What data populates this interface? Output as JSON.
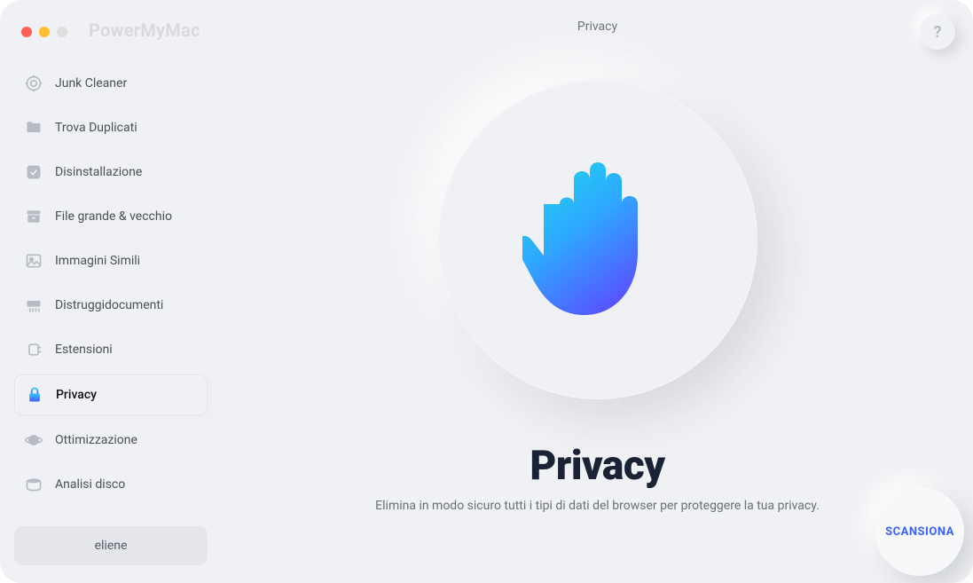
{
  "app_title": "PowerMyMac",
  "header": {
    "page_label": "Privacy",
    "help_label": "?"
  },
  "sidebar": {
    "items": [
      {
        "label": "Junk Cleaner",
        "icon": "target"
      },
      {
        "label": "Trova Duplicati",
        "icon": "folder"
      },
      {
        "label": "Disinstallazione",
        "icon": "app"
      },
      {
        "label": "File grande & vecchio",
        "icon": "box"
      },
      {
        "label": "Immagini Simili",
        "icon": "image"
      },
      {
        "label": "Distruggidocumenti",
        "icon": "shredder"
      },
      {
        "label": "Estensioni",
        "icon": "plugin"
      },
      {
        "label": "Privacy",
        "icon": "lock"
      },
      {
        "label": "Ottimizzazione",
        "icon": "planet"
      },
      {
        "label": "Analisi disco",
        "icon": "disk"
      }
    ],
    "active_index": 7
  },
  "user": {
    "name": "eliene"
  },
  "main": {
    "title": "Privacy",
    "description": "Elimina in modo sicuro tutti i tipi di dati del browser per proteggere la tua privacy."
  },
  "scan_button_label": "SCANSIONA"
}
